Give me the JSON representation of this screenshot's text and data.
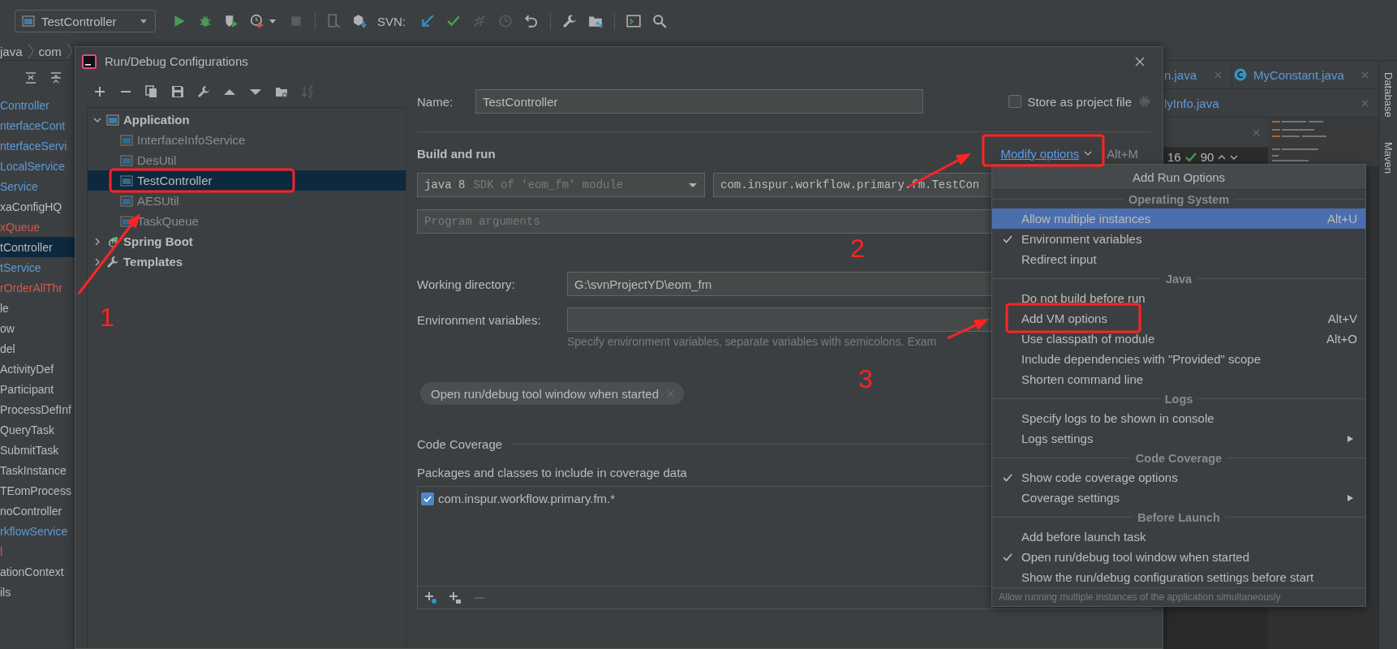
{
  "ide_toolbar": {
    "run_config": "TestController",
    "svn_label": "SVN:"
  },
  "breadcrumb": [
    "java",
    "com"
  ],
  "project_tree": [
    {
      "label": "Controller",
      "color": "#5c9ad8",
      "selected": false
    },
    {
      "label": "nterfaceCont",
      "color": "#5c9ad8",
      "selected": false
    },
    {
      "label": "nterfaceServi",
      "color": "#5c9ad8",
      "selected": false
    },
    {
      "label": "LocalService",
      "color": "#5c9ad8",
      "selected": false
    },
    {
      "label": "Service",
      "color": "#5c9ad8",
      "selected": false
    },
    {
      "label": "xaConfigHQ",
      "color": "#bbbbbb",
      "selected": false
    },
    {
      "label": "xQueue",
      "color": "#d5574b",
      "selected": false
    },
    {
      "label": "tController",
      "color": "#bbbbbb",
      "selected": true
    },
    {
      "label": "tService",
      "color": "#5c9ad8",
      "selected": false
    },
    {
      "label": "rOrderAllThr",
      "color": "#d5574b",
      "selected": false
    },
    {
      "label": "le",
      "color": "#bbbbbb",
      "selected": false
    },
    {
      "label": "ow",
      "color": "#bbbbbb",
      "selected": false
    },
    {
      "label": "del",
      "color": "#bbbbbb",
      "selected": false
    },
    {
      "label": "ActivityDef",
      "color": "#bbbbbb",
      "selected": false
    },
    {
      "label": "Participant",
      "color": "#bbbbbb",
      "selected": false
    },
    {
      "label": "ProcessDefInf",
      "color": "#bbbbbb",
      "selected": false
    },
    {
      "label": "QueryTask",
      "color": "#bbbbbb",
      "selected": false
    },
    {
      "label": "SubmitTask",
      "color": "#bbbbbb",
      "selected": false
    },
    {
      "label": "TaskInstance",
      "color": "#bbbbbb",
      "selected": false
    },
    {
      "label": "TEomProcess",
      "color": "#bbbbbb",
      "selected": false
    },
    {
      "label": "noController",
      "color": "#bbbbbb",
      "selected": false
    },
    {
      "label": "rkflowService",
      "color": "#5c9ad8",
      "selected": false
    },
    {
      "label": "l",
      "color": "#d5574b",
      "selected": false
    },
    {
      "label": "ationContext",
      "color": "#bbbbbb",
      "selected": false
    },
    {
      "label": "ils",
      "color": "#bbbbbb",
      "selected": false
    }
  ],
  "editor": {
    "tab_rows": [
      [
        {
          "label": "n.java",
          "kind": "plain"
        },
        {
          "label": "MyConstant.java",
          "kind": "class"
        }
      ],
      [
        {
          "label": "lyInfo.java",
          "kind": "plain"
        }
      ]
    ],
    "warnings": "16",
    "checks": "90"
  },
  "tool_strip": [
    "Database",
    "Maven"
  ],
  "dialog": {
    "title": "Run/Debug Configurations",
    "tree": [
      {
        "label": "Application",
        "kind": "application",
        "expanded": true,
        "children": [
          {
            "label": "InterfaceInfoService",
            "temporary": true,
            "selected": false
          },
          {
            "label": "DesUtil",
            "temporary": true,
            "selected": false
          },
          {
            "label": "TestController",
            "temporary": false,
            "selected": true
          },
          {
            "label": "AESUtil",
            "temporary": true,
            "selected": false
          },
          {
            "label": "TaskQueue",
            "temporary": true,
            "selected": false
          }
        ]
      },
      {
        "label": "Spring Boot",
        "kind": "spring",
        "expanded": false
      },
      {
        "label": "Templates",
        "kind": "templates",
        "expanded": false
      }
    ],
    "form": {
      "name_label": "Name:",
      "name": "TestController",
      "store_label": "Store as project file",
      "store_checked": false,
      "build_heading": "Build and run",
      "modify_link": "Modify options",
      "modify_shortcut": "Alt+M",
      "jre_main": "java 8",
      "jre_hint": "SDK of 'eom_fm' module",
      "main_class": "com.inspur.workflow.primary.fm.TestCon",
      "program_args_placeholder": "Program arguments",
      "workdir_label": "Working directory:",
      "workdir": "G:\\svnProjectYD\\eom_fm",
      "env_label": "Environment variables:",
      "env_hint": "Specify environment variables, separate variables with semicolons. Exam",
      "chip": "Open run/debug tool window when started",
      "coverage_heading": "Code Coverage",
      "packages_label": "Packages and classes to include in coverage data",
      "packages": [
        {
          "pattern": "com.inspur.workflow.primary.fm.*",
          "checked": true
        }
      ]
    }
  },
  "popup": {
    "title": "Add Run Options",
    "sections": [
      {
        "heading": "Operating System",
        "items": [
          {
            "label": "Allow multiple instances",
            "shortcut": "Alt+U",
            "selected": true,
            "checked": false,
            "submenu": false
          },
          {
            "label": "Environment variables",
            "selected": false,
            "checked": true,
            "submenu": false
          },
          {
            "label": "Redirect input",
            "selected": false,
            "checked": false,
            "submenu": false
          }
        ]
      },
      {
        "heading": "Java",
        "items": [
          {
            "label": "Do not build before run",
            "selected": false,
            "checked": false,
            "submenu": false
          },
          {
            "label": "Add VM options",
            "shortcut": "Alt+V",
            "selected": false,
            "checked": false,
            "submenu": false
          },
          {
            "label": "Use classpath of module",
            "shortcut": "Alt+O",
            "selected": false,
            "checked": false,
            "submenu": false
          },
          {
            "label": "Include dependencies with \"Provided\" scope",
            "selected": false,
            "checked": false,
            "submenu": false
          },
          {
            "label": "Shorten command line",
            "selected": false,
            "checked": false,
            "submenu": false
          }
        ]
      },
      {
        "heading": "Logs",
        "items": [
          {
            "label": "Specify logs to be shown in console",
            "selected": false,
            "checked": false,
            "submenu": false
          },
          {
            "label": "Logs settings",
            "selected": false,
            "checked": false,
            "submenu": true
          }
        ]
      },
      {
        "heading": "Code Coverage",
        "items": [
          {
            "label": "Show code coverage options",
            "selected": false,
            "checked": true,
            "submenu": false
          },
          {
            "label": "Coverage settings",
            "selected": false,
            "checked": false,
            "submenu": true
          }
        ]
      },
      {
        "heading": "Before Launch",
        "items": [
          {
            "label": "Add before launch task",
            "selected": false,
            "checked": false,
            "submenu": false
          },
          {
            "label": "Open run/debug tool window when started",
            "selected": false,
            "checked": true,
            "submenu": false
          },
          {
            "label": "Show the run/debug configuration settings before start",
            "selected": false,
            "checked": false,
            "submenu": false
          }
        ]
      }
    ],
    "footer": "Allow running multiple instances of the application simultaneously"
  },
  "step_labels": [
    "1",
    "2",
    "3"
  ]
}
